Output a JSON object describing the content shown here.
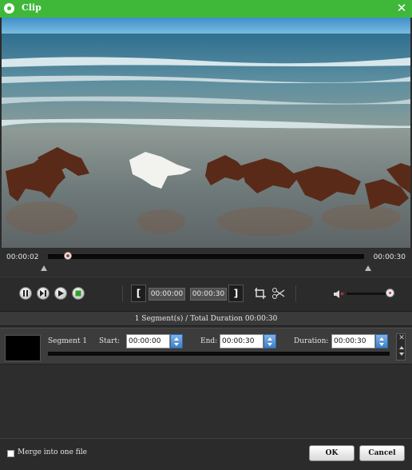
{
  "window": {
    "title": "Clip",
    "close_icon": "close-icon"
  },
  "timeline": {
    "current_time": "00:00:02",
    "total_time": "00:00:30",
    "progress_fraction": 0.067
  },
  "controls": {
    "buttons": [
      "pause-icon",
      "step-forward-icon",
      "play-icon",
      "stop-icon"
    ],
    "start_bracket": "[",
    "end_bracket": "]",
    "start_time": "00:00:00",
    "end_time": "00:00:30",
    "tools": [
      "crop-icon",
      "cut-icon"
    ],
    "volume_fraction": 1.0
  },
  "summary": "1 Segment(s) / Total Duration 00:00:30",
  "segment": {
    "name": "Segment 1",
    "start_label": "Start:",
    "start_value": "00:00:00",
    "end_label": "End:",
    "end_value": "00:00:30",
    "duration_label": "Duration:",
    "duration_value": "00:00:30",
    "remove_glyph": "✕"
  },
  "footer": {
    "merge_label": "Merge into one file",
    "merge_checked": false,
    "ok_label": "OK",
    "cancel_label": "Cancel"
  },
  "colors": {
    "titlebar": "#3fb83a",
    "accent_blue": "#3f7fc6"
  }
}
